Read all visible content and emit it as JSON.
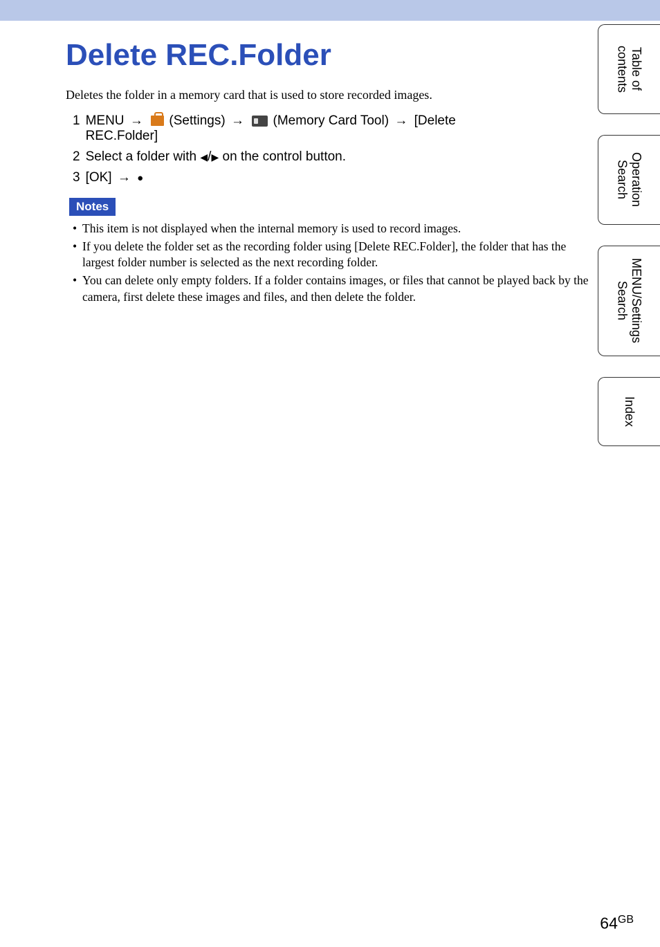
{
  "header": {
    "title": "Delete REC.Folder"
  },
  "intro": "Deletes the folder in a memory card that is used to store recorded images.",
  "steps": [
    {
      "num": "1",
      "prefix": "MENU",
      "settings_label": "(Settings)",
      "tool_label": "(Memory Card Tool)",
      "target": "[Delete",
      "target_line2": "REC.Folder]"
    },
    {
      "num": "2",
      "text_before": "Select a folder with ",
      "text_after": " on the control button."
    },
    {
      "num": "3",
      "ok_label": "[OK]"
    }
  ],
  "notes": {
    "badge": "Notes",
    "items": [
      "This item is not displayed when the internal memory is used to record images.",
      "If you delete the folder set as the recording folder using [Delete REC.Folder], the folder that has the largest folder number is selected as the next recording folder.",
      "You can delete only empty folders. If a folder contains images, or files that cannot be played back by the camera, first delete these images and files, and then delete the folder."
    ]
  },
  "sidebar": {
    "tabs": [
      "Table of contents",
      "Operation Search",
      "MENU/Settings Search",
      "Index"
    ]
  },
  "footer": {
    "page": "64",
    "suffix": "GB"
  }
}
